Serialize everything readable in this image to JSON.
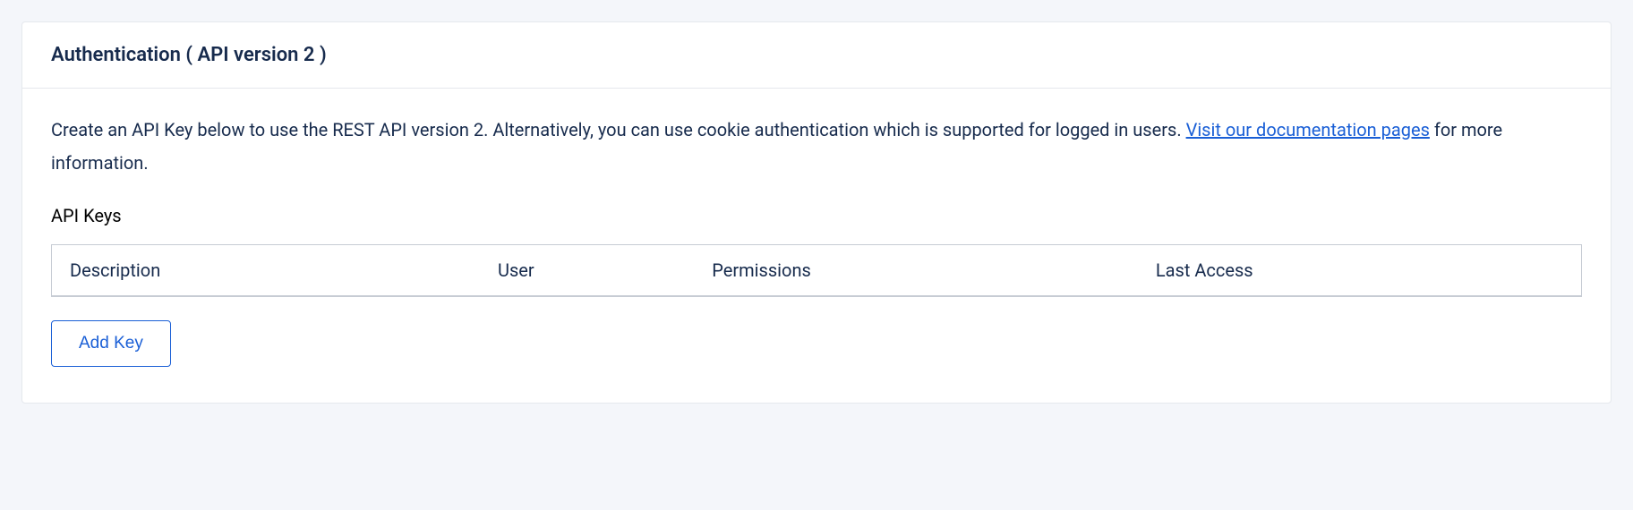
{
  "card": {
    "title": "Authentication ( API version 2 )",
    "description_prefix": "Create an API Key below to use the REST API version 2. Alternatively, you can use cookie authentication which is supported for logged in users. ",
    "doc_link_text": "Visit our documentation pages",
    "description_suffix": " for more information.",
    "section_title": "API Keys",
    "table": {
      "headers": {
        "description": "Description",
        "user": "User",
        "permissions": "Permissions",
        "last_access": "Last Access"
      }
    },
    "add_key_label": "Add Key"
  }
}
